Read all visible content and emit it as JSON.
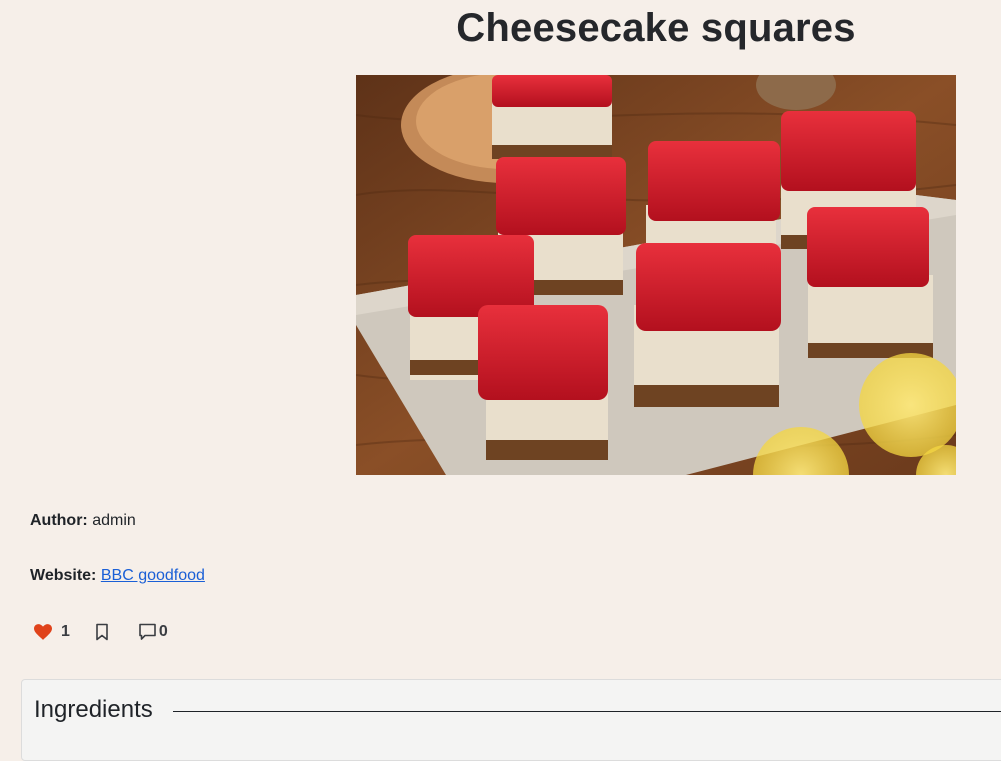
{
  "recipe": {
    "title": "Cheesecake squares",
    "image_alt": "Cheesecake squares"
  },
  "meta": {
    "author_label": "Author:",
    "author_value": "admin",
    "website_label": "Website:",
    "website_value": "BBC goodfood"
  },
  "actions": {
    "likes_count": "1",
    "comments_count": "0",
    "like_icon": "heart-icon",
    "bookmark_icon": "bookmark-icon",
    "comment_icon": "comment-icon"
  },
  "ingredients": {
    "heading": "Ingredients"
  },
  "colors": {
    "background": "#f6efe9",
    "link": "#1a5fd6",
    "heart": "#e0431b",
    "jelly": "#d41f2c"
  }
}
